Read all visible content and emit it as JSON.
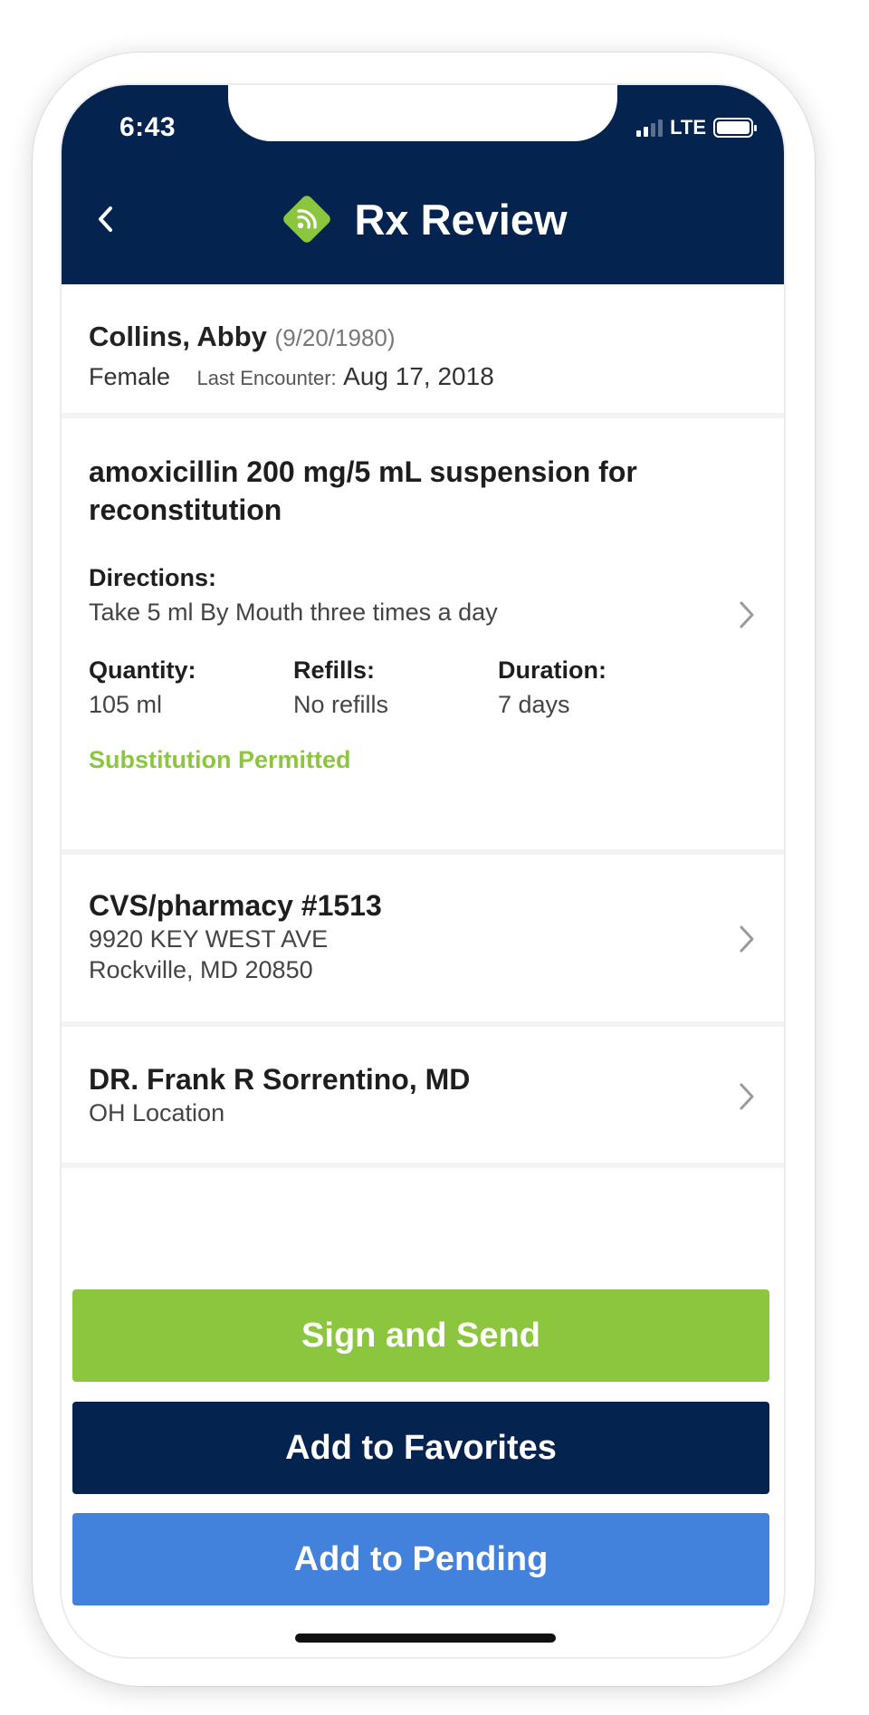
{
  "status_bar": {
    "time": "6:43",
    "network": "LTE"
  },
  "header": {
    "title": "Rx Review"
  },
  "patient": {
    "name": "Collins, Abby",
    "dob": "(9/20/1980)",
    "gender": "Female",
    "last_encounter_label": "Last Encounter:",
    "last_encounter_date": "Aug 17, 2018"
  },
  "prescription": {
    "drug": "amoxicillin 200 mg/5 mL suspension for reconstitution",
    "directions_label": "Directions:",
    "directions": "Take 5 ml By Mouth three times a day",
    "quantity_label": "Quantity:",
    "quantity": "105 ml",
    "refills_label": "Refills:",
    "refills": "No refills",
    "duration_label": "Duration:",
    "duration": "7 days",
    "substitution": "Substitution Permitted"
  },
  "pharmacy": {
    "name": "CVS/pharmacy #1513",
    "address_line1": "9920 KEY WEST AVE",
    "address_line2": "Rockville, MD 20850"
  },
  "prescriber": {
    "name": "DR. Frank R Sorrentino, MD",
    "location": "OH Location"
  },
  "actions": {
    "sign_and_send": "Sign and Send",
    "add_to_favorites": "Add to Favorites",
    "add_to_pending": "Add to Pending"
  },
  "colors": {
    "header_navy": "#04234f",
    "accent_green": "#8cc63f",
    "pending_blue": "#4281dc"
  },
  "icons": {
    "back": "chevron-left-icon",
    "logo": "rx-wireless-logo-icon",
    "row_chevron": "chevron-right-icon",
    "signal": "signal-icon",
    "battery": "battery-icon"
  }
}
